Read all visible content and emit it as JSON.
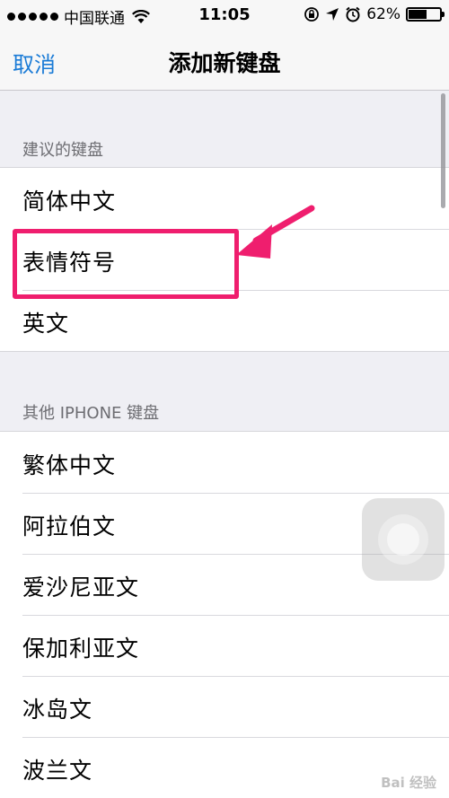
{
  "status_bar": {
    "carrier": "中国联通",
    "time": "11:05",
    "battery_percent": "62%",
    "battery_level": 0.62
  },
  "nav": {
    "cancel_label": "取消",
    "title": "添加新键盘"
  },
  "suggested": {
    "header": "建议的键盘",
    "items": [
      "简体中文",
      "表情符号",
      "英文"
    ]
  },
  "other": {
    "header": "其他 IPHONE 键盘",
    "items": [
      "繁体中文",
      "阿拉伯文",
      "爱沙尼亚文",
      "保加利亚文",
      "冰岛文",
      "波兰文"
    ]
  },
  "colors": {
    "accent": "#1a7bd6",
    "highlight": "#ef1e6e"
  },
  "watermark": "Bai 经验"
}
